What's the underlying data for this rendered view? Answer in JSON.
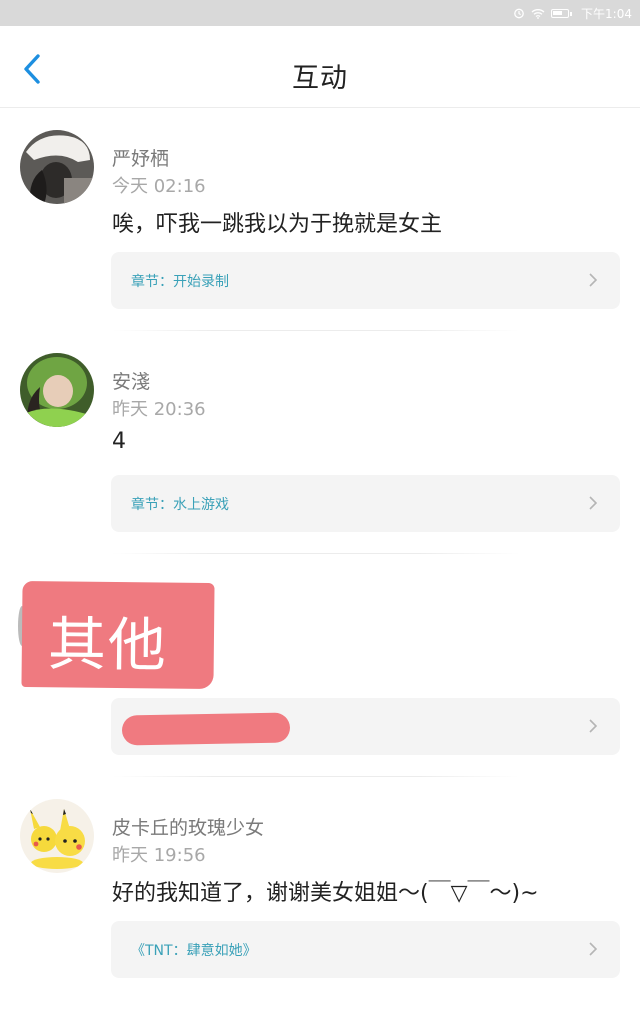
{
  "status_bar": {
    "time": "下午1:04"
  },
  "header": {
    "title": "互动"
  },
  "items": [
    {
      "name": "严妤栖",
      "time": "今天 02:16",
      "content": "唉，吓我一跳我以为于挽就是女主",
      "chapter": "章节：开始录制"
    },
    {
      "name": "安淺",
      "time": "昨天 20:36",
      "content": "4",
      "chapter": "章节：水上游戏"
    },
    {
      "redaction_label": "其他"
    },
    {
      "name": "皮卡丘的玫瑰少女",
      "time": "昨天 19:56",
      "content": "好的我知道了，谢谢美女姐姐～(￣▽￣～)~",
      "chapter": "《TNT：肆意如她》"
    }
  ],
  "colors": {
    "accent": "#1d8fe0",
    "chapter_text": "#3aa1b8",
    "redaction": "#ef7a80"
  }
}
